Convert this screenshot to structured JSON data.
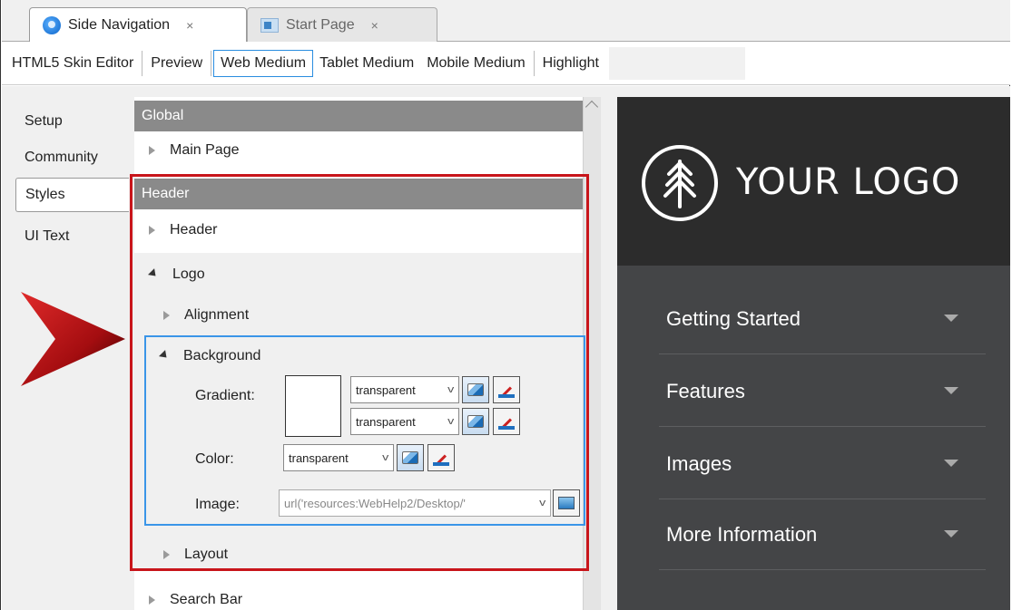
{
  "tabs": [
    {
      "label": "Side Navigation",
      "close": "×",
      "icon": "app-icon"
    },
    {
      "label": "Start Page",
      "close": "×",
      "icon": "page-icon"
    }
  ],
  "toolbar": {
    "skin_editor": "HTML5 Skin Editor",
    "preview": "Preview",
    "web_medium": "Web Medium",
    "tablet_medium": "Tablet Medium",
    "mobile_medium": "Mobile Medium",
    "highlight": "Highlight"
  },
  "left_tabs": [
    "Setup",
    "Community",
    "Styles",
    "UI Text"
  ],
  "tree": {
    "global_section": "Global",
    "main_page": "Main Page",
    "header_section": "Header",
    "header_item": "Header",
    "logo": "Logo",
    "alignment": "Alignment",
    "background": "Background",
    "gradient_label": "Gradient:",
    "gradient_value_1": "transparent",
    "gradient_value_2": "transparent",
    "color_label": "Color:",
    "color_value": "transparent",
    "image_label": "Image:",
    "image_value": "url('resources:WebHelp2/Desktop/'",
    "layout": "Layout",
    "search_bar": "Search Bar"
  },
  "preview": {
    "logo_text": "YOUR LOGO",
    "nav_items": [
      "Getting Started",
      "Features",
      "Images",
      "More Information"
    ]
  },
  "colors": {
    "highlight_red": "#c8151b",
    "highlight_blue": "#3a95e8",
    "section_header": "#8a8a8a",
    "preview_header": "#2c2c2c",
    "preview_nav": "#444547"
  }
}
